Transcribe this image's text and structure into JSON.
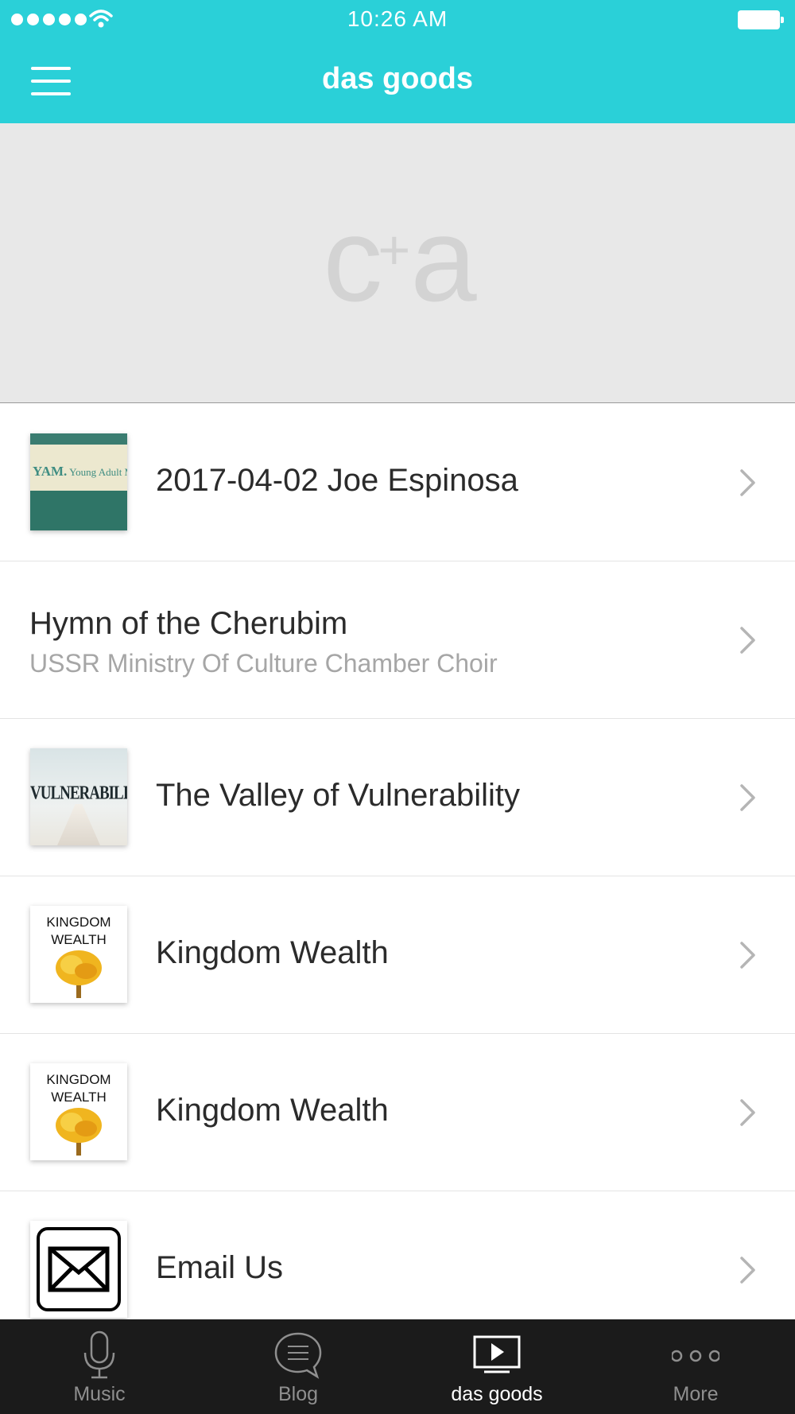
{
  "status_bar": {
    "time": "10:26 AM"
  },
  "header": {
    "title": "das goods"
  },
  "banner": {
    "logo_left": "c",
    "logo_plus": "+",
    "logo_right": "a"
  },
  "list": [
    {
      "title": "2017-04-02 Joe Espinosa",
      "thumb": "yam",
      "thumb_text_main": "YAM.",
      "thumb_text_sub": "Young Adult Ministry"
    },
    {
      "title": "Hymn of the Cherubim",
      "subtitle": "USSR Ministry Of Culture Chamber Choir"
    },
    {
      "title": "The Valley of Vulnerability",
      "thumb": "valley",
      "thumb_text": "VULNERABILITY"
    },
    {
      "title": "Kingdom Wealth",
      "thumb": "kingdom",
      "thumb_text_1": "KINGDOM",
      "thumb_text_2": "WEALTH"
    },
    {
      "title": "Kingdom Wealth",
      "thumb": "kingdom",
      "thumb_text_1": "KINGDOM",
      "thumb_text_2": "WEALTH"
    },
    {
      "title": "Email Us",
      "thumb": "email-icon"
    }
  ],
  "tabs": [
    {
      "label": "Music",
      "icon": "microphone-icon",
      "active": false
    },
    {
      "label": "Blog",
      "icon": "chat-bubble-icon",
      "active": false
    },
    {
      "label": "das goods",
      "icon": "video-play-icon",
      "active": true
    },
    {
      "label": "More",
      "icon": "more-dots-icon",
      "active": false
    }
  ],
  "colors": {
    "header": "#2ad0d8",
    "tabbar": "#1b1b1b",
    "banner": "#e8e8e8"
  }
}
